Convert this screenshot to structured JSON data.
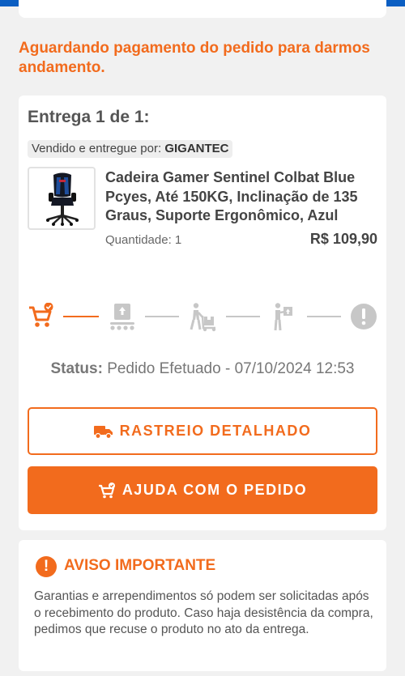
{
  "header": {
    "payment_message": "Aguardando pagamento do pedido para darmos andamento."
  },
  "delivery": {
    "title": "Entrega 1 de 1:",
    "seller_prefix": "Vendido e entregue por:",
    "seller_name": "GIGANTEC",
    "product": {
      "name": "Cadeira Gamer Sentinel Colbat Blue Pcyes, Até 150KG, Inclinação de 135 Graus,  Suporte Ergonômico, Azul",
      "quantity": "Quantidade: 1",
      "price": "R$ 109,90"
    },
    "tracker": {
      "steps": [
        {
          "icon": "cart-check-icon",
          "active": true
        },
        {
          "icon": "package-conveyor-icon",
          "active": false
        },
        {
          "icon": "delivery-person-icon",
          "active": false
        },
        {
          "icon": "person-package-icon",
          "active": false
        },
        {
          "icon": "alert-circle-icon",
          "active": false
        }
      ]
    },
    "status_label": "Status:",
    "status_value": "Pedido Efetuado - 07/10/2024 12:53",
    "tracking_button": "RASTREIO DETALHADO",
    "help_button": "AJUDA COM O PEDIDO"
  },
  "notice": {
    "title": "AVISO IMPORTANTE",
    "icon_text": "!",
    "text": "Garantias e arrependimentos só podem ser solicitadas após o recebimento do produto. Caso haja desistência da compra, pedimos que recuse o produto no ato da entrega."
  },
  "colors": {
    "accent": "#f26b1d",
    "topbar": "#0b5ec2",
    "inactive": "#c7c7c7",
    "background": "#f1f1f1"
  }
}
